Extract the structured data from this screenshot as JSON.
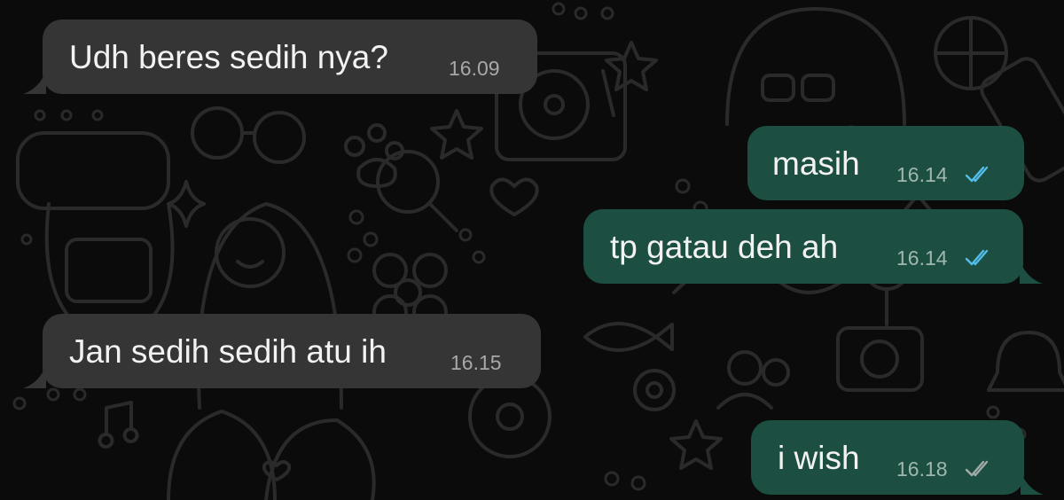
{
  "chat": {
    "messages": [
      {
        "direction": "incoming",
        "text": "Udh beres sedih nya?",
        "time": "16.09"
      },
      {
        "direction": "outgoing",
        "text": "masih",
        "time": "16.14",
        "status": "read"
      },
      {
        "direction": "outgoing",
        "text": "tp gatau deh ah",
        "time": "16.14",
        "status": "read"
      },
      {
        "direction": "incoming",
        "text": "Jan sedih sedih atu ih",
        "time": "16.15"
      },
      {
        "direction": "outgoing",
        "text": "i wish",
        "time": "16.18",
        "status": "delivered"
      }
    ]
  },
  "colors": {
    "background": "#0b0b0b",
    "incoming_bubble": "#353535",
    "outgoing_bubble": "#1c4f41",
    "read_ticks": "#53bdeb",
    "delivered_ticks": "#a3aba8"
  },
  "icons": {
    "read_receipt": "double-check-icon",
    "wallpaper": "doodle-pattern"
  }
}
